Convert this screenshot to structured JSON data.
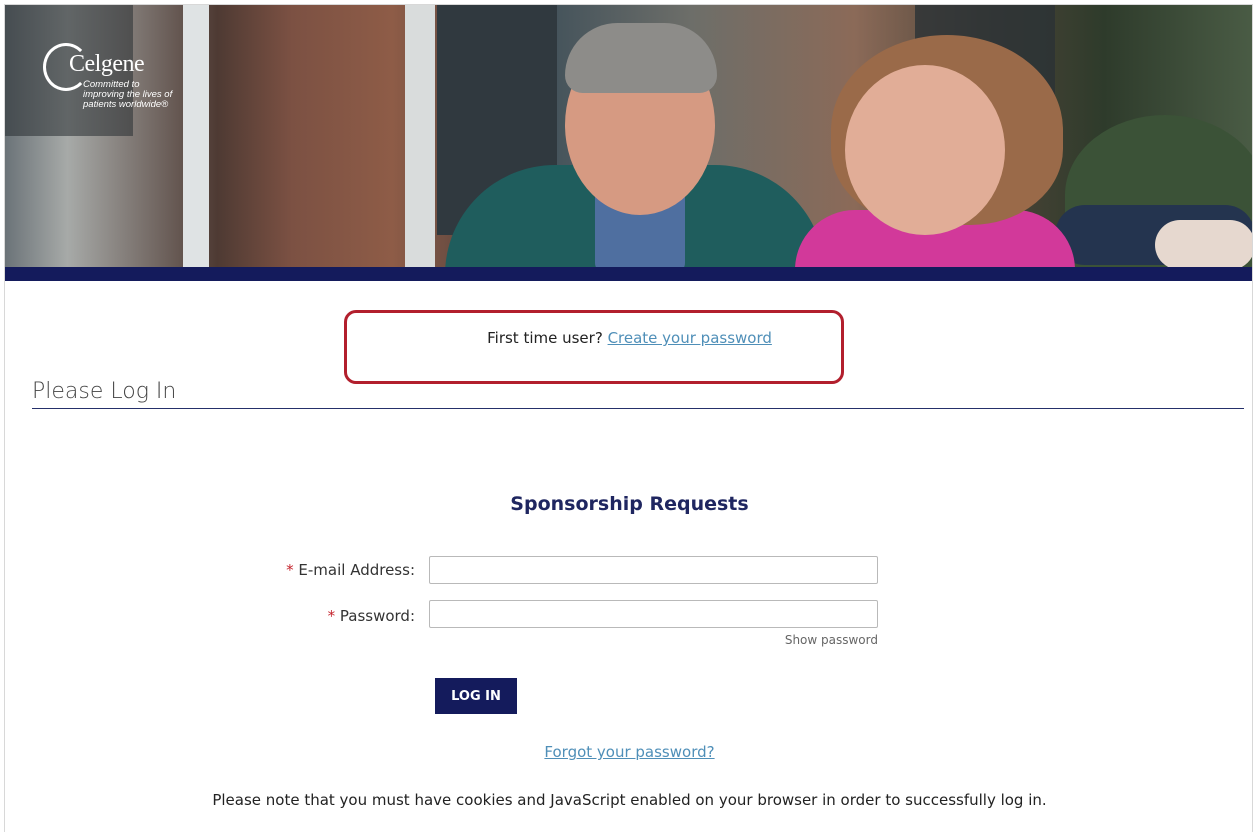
{
  "brand": {
    "name": "Celgene",
    "tagline": "Committed to improving the lives of patients worldwide®"
  },
  "colors": {
    "navy": "#141b5c",
    "highlight_border": "#b21f2d",
    "link": "#4f8fb8",
    "required": "#c5242d"
  },
  "banner": {
    "first_time_prefix": "First time user?",
    "create_password_link": "Create your password"
  },
  "section": {
    "title": "Please Log In"
  },
  "form": {
    "title": "Sponsorship Requests",
    "required_marker": "*",
    "email_label": "E-mail Address:",
    "email_value": "",
    "password_label": "Password:",
    "password_value": "",
    "show_password": "Show password",
    "login_button": "LOG IN",
    "forgot_link": "Forgot your password?",
    "note": "Please note that you must have cookies and JavaScript enabled on your browser in order to successfully log in."
  }
}
